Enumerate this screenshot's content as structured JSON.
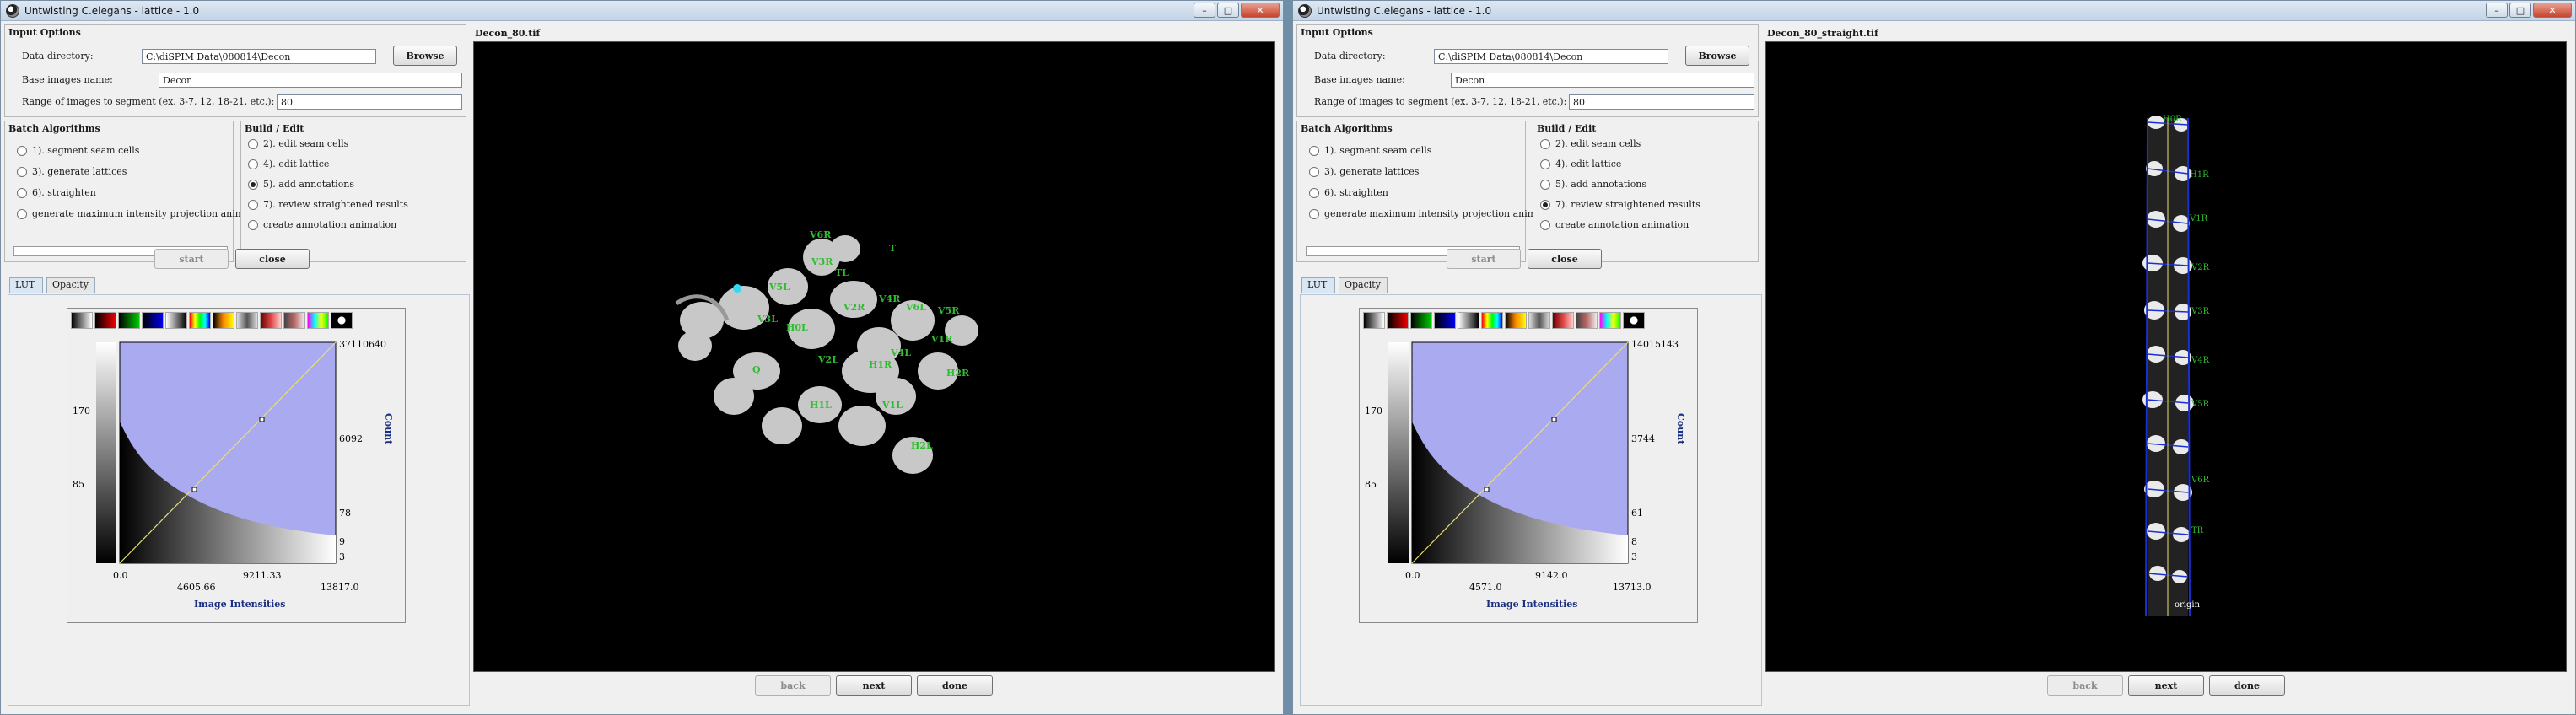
{
  "windows": [
    {
      "title": "Untwisting C.elegans - lattice - 1.0",
      "input_options": {
        "title": "Input Options",
        "data_dir_label": "Data directory:",
        "data_dir_value": "C:\\diSPIM Data\\080814\\Decon",
        "browse_label": "Browse",
        "base_name_label": "Base images name:",
        "base_name_value": "Decon",
        "range_label": "Range of images to segment (ex. 3-7, 12, 18-21, etc.):",
        "range_value": "80"
      },
      "batch": {
        "title": "Batch Algorithms",
        "items": [
          {
            "label": "1). segment seam cells",
            "selected": false
          },
          {
            "label": "3). generate lattices",
            "selected": false
          },
          {
            "label": "6). straighten",
            "selected": false
          },
          {
            "label": "generate maximum intensity projection animation",
            "selected": false
          }
        ]
      },
      "build": {
        "title": "Build / Edit",
        "items": [
          {
            "label": "2). edit seam cells",
            "selected": false
          },
          {
            "label": "4). edit lattice",
            "selected": false
          },
          {
            "label": "5). add annotations",
            "selected": true
          },
          {
            "label": "7). review straightened results",
            "selected": false
          },
          {
            "label": "create annotation animation",
            "selected": false
          }
        ]
      },
      "start_label": "start",
      "close_label": "close",
      "tabs": [
        "LUT",
        "Opacity"
      ],
      "lut": {
        "y_ticks": [
          "170",
          "85"
        ],
        "count_ticks": [
          "37110640",
          "6092",
          "78",
          "9",
          "3"
        ],
        "count_label": "Count",
        "x_ticks": [
          "0.0",
          "4605.66",
          "9211.33",
          "13817.0"
        ],
        "x_label": "Image Intensities"
      },
      "image_title": "Decon_80.tif",
      "labels": [
        "V6R",
        "T",
        "TL",
        "V5L",
        "V4R",
        "V3R",
        "V2R",
        "V6L",
        "V5R",
        "V3L",
        "V1R",
        "H2R",
        "H0L",
        "V4L",
        "H1R",
        "V2L",
        "V1L",
        "H1L",
        "H2L",
        "Q"
      ],
      "back_label": "back",
      "next_label": "next",
      "done_label": "done"
    },
    {
      "title": "Untwisting C.elegans - lattice - 1.0",
      "input_options": {
        "title": "Input Options",
        "data_dir_label": "Data directory:",
        "data_dir_value": "C:\\diSPIM Data\\080814\\Decon",
        "browse_label": "Browse",
        "base_name_label": "Base images name:",
        "base_name_value": "Decon",
        "range_label": "Range of images to segment (ex. 3-7, 12, 18-21, etc.):",
        "range_value": "80"
      },
      "batch": {
        "title": "Batch Algorithms",
        "items": [
          {
            "label": "1). segment seam cells",
            "selected": false
          },
          {
            "label": "3). generate lattices",
            "selected": false
          },
          {
            "label": "6). straighten",
            "selected": false
          },
          {
            "label": "generate maximum intensity projection animation",
            "selected": false
          }
        ]
      },
      "build": {
        "title": "Build / Edit",
        "items": [
          {
            "label": "2). edit seam cells",
            "selected": false
          },
          {
            "label": "4). edit lattice",
            "selected": false
          },
          {
            "label": "5). add annotations",
            "selected": false
          },
          {
            "label": "7). review straightened results",
            "selected": true
          },
          {
            "label": "create annotation animation",
            "selected": false
          }
        ]
      },
      "start_label": "start",
      "close_label": "close",
      "tabs": [
        "LUT",
        "Opacity"
      ],
      "lut": {
        "y_ticks": [
          "170",
          "85"
        ],
        "count_ticks": [
          "14015143",
          "3744",
          "61",
          "8",
          "3"
        ],
        "count_label": "Count",
        "x_ticks": [
          "0.0",
          "4571.0",
          "9142.0",
          "13713.0"
        ],
        "x_label": "Image Intensities"
      },
      "image_title": "Decon_80_straight.tif",
      "labels": [
        "H0R",
        "H1R",
        "V1R",
        "V2R",
        "V3R",
        "V4R",
        "V5R",
        "V6R",
        "TR",
        "origin"
      ],
      "back_label": "back",
      "next_label": "next",
      "done_label": "done"
    }
  ],
  "colors": {
    "histogram_fill": "#aaaaf0",
    "label_green": "#2ebd2e",
    "lattice_blue": "#1a2fd0",
    "selection_cyan": "#35d8f0"
  }
}
